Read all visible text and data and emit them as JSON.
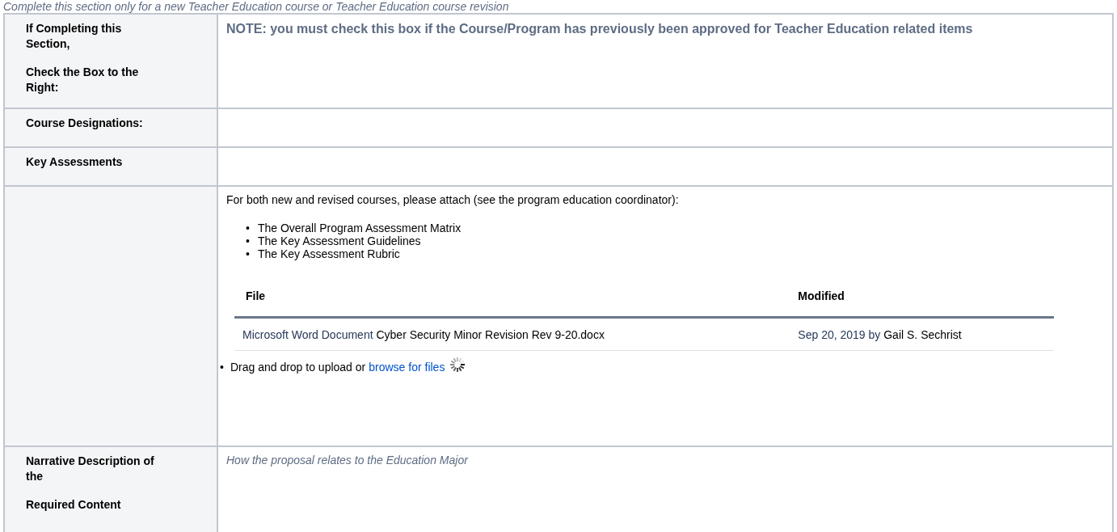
{
  "section_note": "Complete this section only for a new Teacher Education course or Teacher Education course revision",
  "rows": [
    {
      "kind": "note",
      "header_lines": [
        "If Completing this Section,",
        "Check the Box to the Right:"
      ],
      "note": "NOTE: you must check this box if the Course/Program has previously been approved for Teacher Education related items"
    },
    {
      "kind": "empty",
      "header_lines": [
        "Course Designations:"
      ]
    },
    {
      "kind": "empty",
      "header_lines": [
        "Key Assessments"
      ]
    },
    {
      "kind": "attachments",
      "header_lines": [],
      "intro": "For both new and revised courses, please attach (see the program education coordinator):",
      "bullet_marker": "•",
      "bullets": [
        "The Overall Program Assessment Matrix",
        "The Key Assessment Guidelines",
        "The Key Assessment Rubric"
      ],
      "files_table": {
        "columns": [
          "File",
          "Modified"
        ],
        "rows": [
          {
            "file_type": "Microsoft Word Document",
            "file_name": "Cyber Security Minor Revision Rev 9-20.docx",
            "date": "Sep 20, 2019",
            "by": "by",
            "author": "Gail S. Sechrist"
          }
        ]
      },
      "upload": {
        "marker": "•",
        "text": "Drag and drop to upload or",
        "link": "browse for files"
      }
    },
    {
      "kind": "placeholder",
      "header_lines": [
        "Narrative Description of the",
        "Required Content"
      ],
      "placeholder": "How the proposal relates to the Education Major"
    }
  ]
}
